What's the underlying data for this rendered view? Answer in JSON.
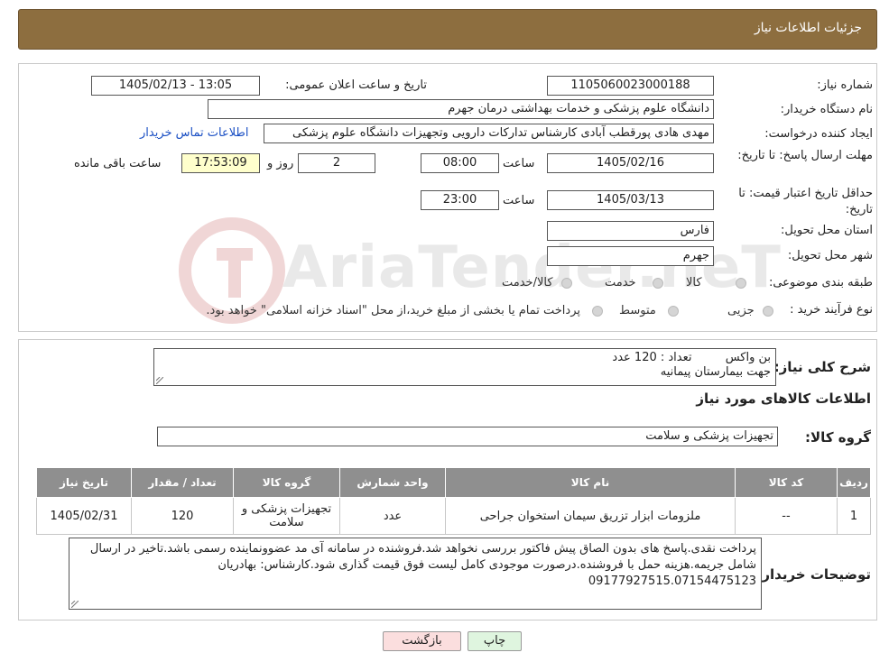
{
  "header": {
    "title": "جزئیات اطلاعات نیاز"
  },
  "form": {
    "need_number_label": "شماره نیاز:",
    "need_number": "1105060023000188",
    "announce_label": "تاریخ و ساعت اعلان عمومی:",
    "announce_value": "1405/02/13 - 13:05",
    "buyer_org_label": "نام دستگاه خریدار:",
    "buyer_org": "دانشگاه علوم پزشکی و خدمات بهداشتی  درمان جهرم",
    "creator_label": "ایجاد کننده درخواست:",
    "creator": "مهدی هادی پورقطب آبادی کارشناس تدارکات دارویی وتجهیزات دانشگاه علوم پزشکی",
    "contact_link": "اطلاعات تماس خریدار",
    "deadline_label": "مهلت ارسال پاسخ: تا تاریخ:",
    "deadline_date": "1405/02/16",
    "time_label": "ساعت",
    "deadline_time": "08:00",
    "days_value": "2",
    "days_label": "روز و",
    "remaining_time": "17:53:09",
    "remaining_label": "ساعت باقی مانده",
    "validity_label": "حداقل تاریخ اعتبار قیمت: تا تاریخ:",
    "validity_date": "1405/03/13",
    "validity_time": "23:00",
    "province_label": "استان محل تحویل:",
    "province": "فارس",
    "city_label": "شهر محل تحویل:",
    "city": "جهرم",
    "category_label": "طبقه بندی موضوعی:",
    "category_options": [
      "کالا",
      "خدمت",
      "کالا/خدمت"
    ],
    "process_label": "نوع فرآیند خرید :",
    "process_options": [
      "جزیی",
      "متوسط"
    ],
    "process_note": "پرداخت تمام یا بخشی از مبلغ خرید،از محل \"اسناد خزانه اسلامی\" خواهد بود."
  },
  "summary": {
    "label": "شرح کلی نیاز:",
    "line1": "بن واکس         تعداد : 120 عدد",
    "line2": "جهت بیمارستان پیمانیه"
  },
  "goods": {
    "section_title": "اطلاعات کالاهای مورد نیاز",
    "group_label": "گروه کالا:",
    "group_value": "تجهیزات پزشکی و سلامت"
  },
  "table": {
    "headers": [
      "ردیف",
      "کد کالا",
      "نام کالا",
      "واحد شمارش",
      "گروه کالا",
      "تعداد / مقدار",
      "تاریخ نیاز"
    ],
    "rows": [
      {
        "row": "1",
        "code": "--",
        "name": "ملزومات ابزار تزریق سیمان استخوان جراحی",
        "unit": "عدد",
        "group": "تجهیزات پزشکی و سلامت",
        "qty": "120",
        "date": "1405/02/31"
      }
    ]
  },
  "notes": {
    "label": "توضیحات خریدار:",
    "text": "پرداخت نقدی.پاسخ های بدون الصاق پیش فاکتور بررسی نخواهد شد.فروشنده در سامانه آی مد عضوونماینده رسمی باشد.تاخیر در ارسال شامل جریمه.هزینه حمل با فروشنده.درصورت موجودی کامل لیست فوق قیمت گذاری شود.کارشناس: بهادریان 09177927515.07154475123"
  },
  "buttons": {
    "print": "چاپ",
    "back": "بازگشت"
  },
  "watermark": {
    "text": "AriaTender.neT"
  },
  "colors": {
    "header_bg": "#8d6e3f",
    "table_header_bg": "#8f8f8f",
    "remaining_bg": "#ffffcc",
    "print_btn_bg": "#dff5df",
    "back_btn_bg": "#fbdede",
    "link": "#1a4fc4"
  }
}
